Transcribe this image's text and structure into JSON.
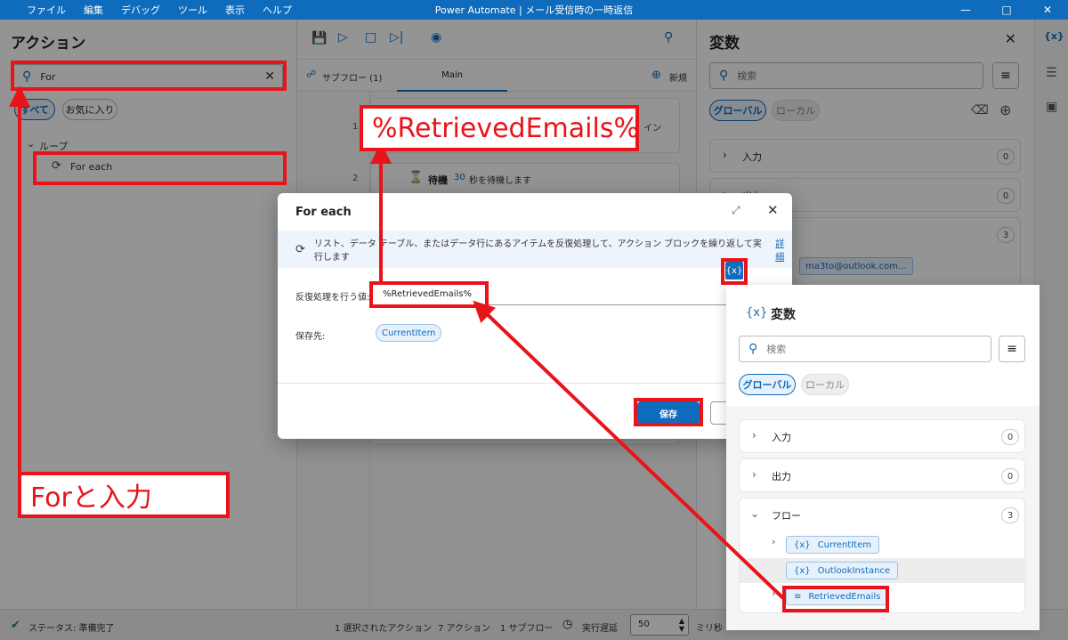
{
  "titlebar": {
    "menu": [
      "ファイル",
      "編集",
      "デバッグ",
      "ツール",
      "表示",
      "ヘルプ"
    ],
    "title": "Power Automate | メール受信時の一時返信"
  },
  "actions_panel": {
    "title": "アクション",
    "search_value": "For",
    "filters": [
      "すべて",
      "お気に入り"
    ],
    "group_label": "ループ",
    "item_label": "For each"
  },
  "center": {
    "subflow_label": "サブフロー (1)",
    "main_tab": "Main",
    "new_label": "新規",
    "row_numbers": [
      "1",
      "2"
    ],
    "row1_tail": "イン",
    "wait_action": {
      "name": "待機",
      "seconds": "30",
      "suffix": "秒を待機します"
    }
  },
  "vars_panel": {
    "title": "変数",
    "search_placeholder": "検索",
    "scopes": [
      "グローバル",
      "ローカル"
    ],
    "sections": [
      {
        "label": "入力",
        "count": "0"
      },
      {
        "label": "出力",
        "count": "0"
      },
      {
        "label": "",
        "count": "3"
      }
    ],
    "chip_value": "ma3to@outlook.com..."
  },
  "dialog": {
    "title": "For each",
    "info_text": "リスト、データ テーブル、またはデータ行にあるアイテムを反復処理して、アクション ブロックを繰り返して実行します",
    "info_link": "詳細",
    "iterate_label": "反復処理を行う値:",
    "iterate_value": "%RetrievedEmails%",
    "store_label": "保存先:",
    "store_value": "CurrentItem",
    "save_label": "保存",
    "var_button": "{x}"
  },
  "vars_popup": {
    "icon": "{x}",
    "title": "変数",
    "search_placeholder": "検索",
    "scopes": [
      "グローバル",
      "ローカル"
    ],
    "sections": [
      {
        "label": "入力",
        "count": "0"
      },
      {
        "label": "出力",
        "count": "0"
      },
      {
        "label": "フロー",
        "count": "3"
      }
    ],
    "flow_vars": [
      "CurrentItem",
      "OutlookInstance",
      "RetrievedEmails"
    ]
  },
  "statusbar": {
    "status": "ステータス: 準備完了",
    "selected": "1 選択されたアクション",
    "actions": "7 アクション",
    "subflows": "1 サブフロー",
    "delay_label": "実行遅延",
    "delay_value": "50",
    "unit": "ミリ秒"
  },
  "annotations": {
    "top_label": "%RetrievedEmails%",
    "bottom_label": "Forと入力",
    "color": "#e8141a"
  }
}
